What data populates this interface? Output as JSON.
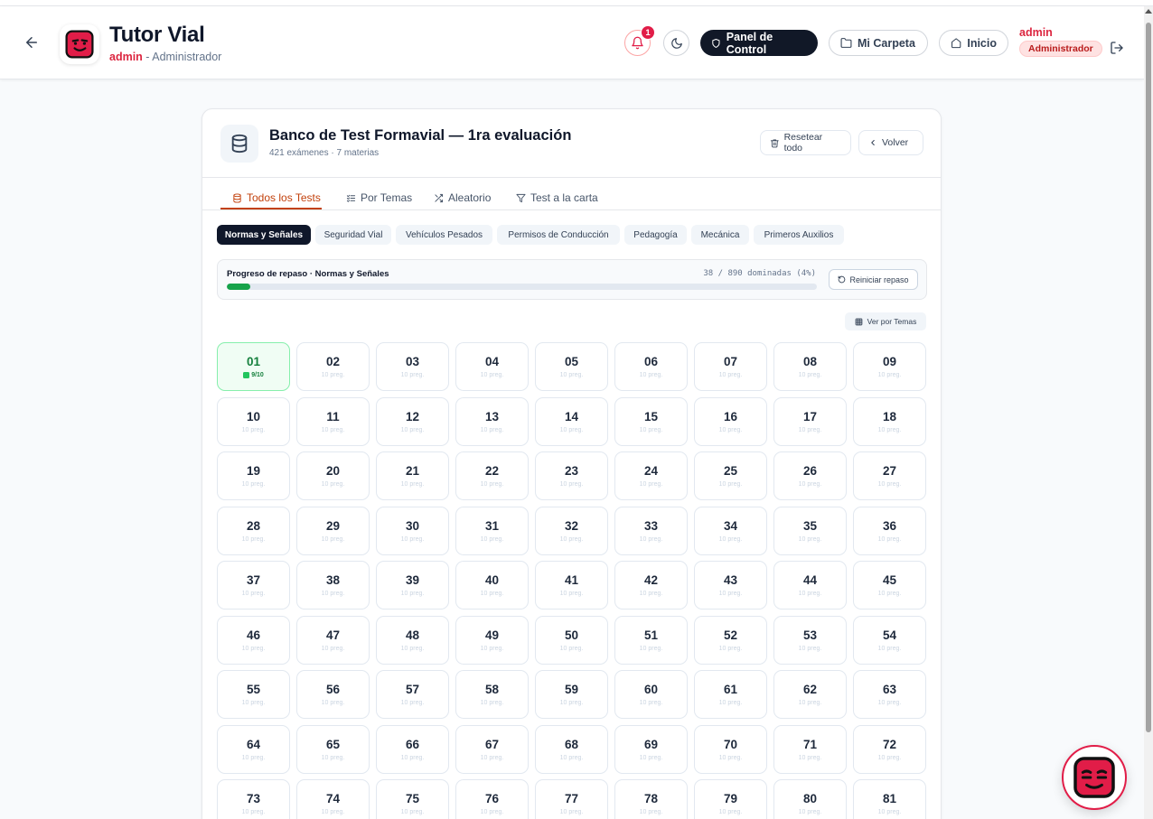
{
  "header": {
    "title": "Tutor Vial",
    "user_link": "admin",
    "separator": " - ",
    "role_text": "Administrador",
    "notifications_count": "1",
    "control_panel_label": "Panel de Control",
    "folder_label": "Mi Carpeta",
    "home_label": "Inicio",
    "user_name": "admin",
    "user_role_badge": "Administrador"
  },
  "bank": {
    "title": "Banco de Test Formavial — 1ra evaluación",
    "subtitle": "421 exámenes · 7 materias",
    "reset_label": "Resetear todo",
    "back_label": "Volver"
  },
  "tabs": [
    {
      "label": "Todos los Tests",
      "active": true
    },
    {
      "label": "Por Temas",
      "active": false
    },
    {
      "label": "Aleatorio",
      "active": false
    },
    {
      "label": "Test a la carta",
      "active": false
    }
  ],
  "subjects": [
    {
      "label": "Normas y Señales",
      "active": true
    },
    {
      "label": "Seguridad Vial",
      "active": false
    },
    {
      "label": "Vehículos Pesados",
      "active": false
    },
    {
      "label": "Permisos de Conducción",
      "active": false
    },
    {
      "label": "Pedagogía",
      "active": false
    },
    {
      "label": "Mecánica",
      "active": false
    },
    {
      "label": "Primeros Auxilios",
      "active": false
    }
  ],
  "progress": {
    "label": "Progreso de repaso · Normas y Señales",
    "count_text": "38 / 890 dominadas (4%)",
    "percent": 4,
    "restart_label": "Reiniciar repaso"
  },
  "view_by_topics_label": "Ver por Temas",
  "tests": {
    "default_sub": "10 preg.",
    "done_sub": "9/10",
    "done_ids": [
      "01"
    ],
    "ids": [
      "01",
      "02",
      "03",
      "04",
      "05",
      "06",
      "07",
      "08",
      "09",
      "10",
      "11",
      "12",
      "13",
      "14",
      "15",
      "16",
      "17",
      "18",
      "19",
      "20",
      "21",
      "22",
      "23",
      "24",
      "25",
      "26",
      "27",
      "28",
      "29",
      "30",
      "31",
      "32",
      "33",
      "34",
      "35",
      "36",
      "37",
      "38",
      "39",
      "40",
      "41",
      "42",
      "43",
      "44",
      "45",
      "46",
      "47",
      "48",
      "49",
      "50",
      "51",
      "52",
      "53",
      "54",
      "55",
      "56",
      "57",
      "58",
      "59",
      "60",
      "61",
      "62",
      "63",
      "64",
      "65",
      "66",
      "67",
      "68",
      "69",
      "70",
      "71",
      "72",
      "73",
      "74",
      "75",
      "76",
      "77",
      "78",
      "79",
      "80",
      "81"
    ]
  },
  "colors": {
    "brand_red": "#dc2640",
    "accent_orange": "#c2410c",
    "success_green": "#16a34a"
  }
}
